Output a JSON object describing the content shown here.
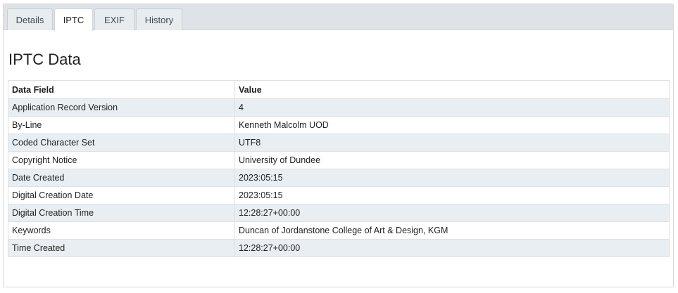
{
  "tabs": [
    {
      "label": "Details"
    },
    {
      "label": "IPTC"
    },
    {
      "label": "EXIF"
    },
    {
      "label": "History"
    }
  ],
  "active_tab": "IPTC",
  "page_title": "IPTC Data",
  "table": {
    "headers": [
      "Data Field",
      "Value"
    ],
    "rows": [
      {
        "field": "Application Record Version",
        "value": "4"
      },
      {
        "field": "By-Line",
        "value": "Kenneth Malcolm UOD"
      },
      {
        "field": "Coded Character Set",
        "value": "UTF8"
      },
      {
        "field": "Copyright Notice",
        "value": "University of Dundee"
      },
      {
        "field": "Date Created",
        "value": "2023:05:15"
      },
      {
        "field": "Digital Creation Date",
        "value": "2023:05:15"
      },
      {
        "field": "Digital Creation Time",
        "value": "12:28:27+00:00"
      },
      {
        "field": "Keywords",
        "value": "Duncan of Jordanstone College of Art & Design, KGM"
      },
      {
        "field": "Time Created",
        "value": "12:28:27+00:00"
      }
    ]
  },
  "colors": {
    "tabbar_bg": "#dfe3e8",
    "row_stripe": "#e9eef2",
    "border": "#dde1e5"
  }
}
